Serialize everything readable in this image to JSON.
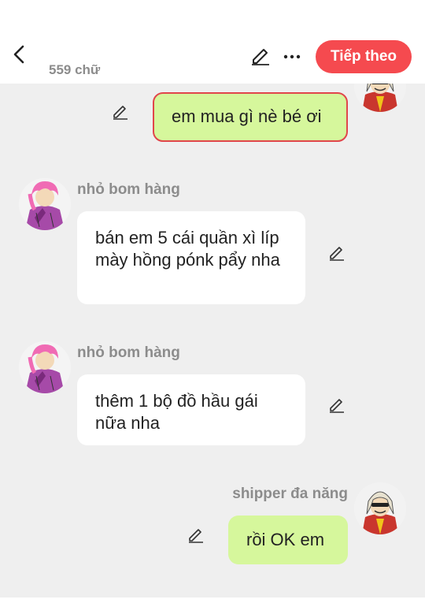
{
  "header": {
    "word_count": "559 chữ",
    "next_label": "Tiếp theo",
    "icons": {
      "back": "chevron-left-icon",
      "edit": "pencil-icon",
      "more": "more-horizontal-icon"
    }
  },
  "colors": {
    "accent": "#f54a4f",
    "bubble_right": "#d6f79c",
    "bubble_left": "#ffffff",
    "background": "#efefef",
    "selected_border": "#e1464b",
    "name_text": "#8c8c8c"
  },
  "messages": [
    {
      "side": "right",
      "sender": "",
      "text": "em mua gì nè bé ơi",
      "selected": true
    },
    {
      "side": "left",
      "sender": "nhỏ bom hàng",
      "text": "bán em 5 cái quần xì líp mày hồng pónk pẩy nha",
      "selected": false
    },
    {
      "side": "left",
      "sender": "nhỏ bom hàng",
      "text": "thêm 1 bộ đồ hầu gái nữa nha",
      "selected": false
    },
    {
      "side": "right",
      "sender": "shipper đa năng",
      "text": "rồi OK em",
      "selected": false
    }
  ]
}
